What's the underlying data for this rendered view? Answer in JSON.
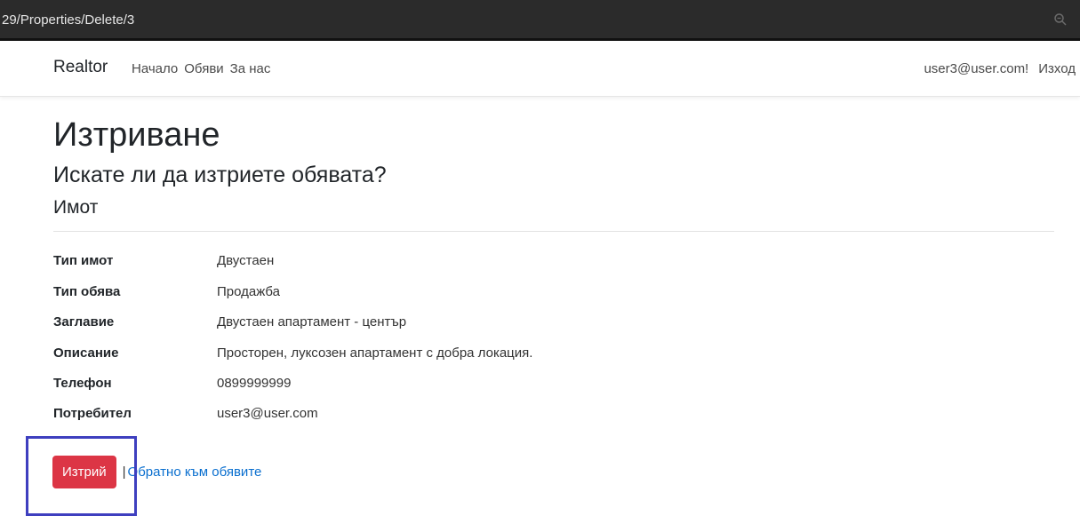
{
  "browser": {
    "url": "29/Properties/Delete/3",
    "zoom_icon": "magnifier-icon"
  },
  "navbar": {
    "brand": "Realtor",
    "links": [
      "Начало",
      "Обяви",
      "За нас"
    ],
    "user": "user3@user.com!",
    "logout": "Изход"
  },
  "page": {
    "title": "Изтриване",
    "question": "Искате ли да изтриете обявата?",
    "section": "Имот"
  },
  "details": [
    {
      "label": "Тип имот",
      "value": "Двустаен"
    },
    {
      "label": "Тип обява",
      "value": "Продажба"
    },
    {
      "label": "Заглавие",
      "value": "Двустаен апартамент - център"
    },
    {
      "label": "Описание",
      "value": "Просторен, луксозен апартамент с добра локация."
    },
    {
      "label": "Телефон",
      "value": "0899999999"
    },
    {
      "label": "Потребител",
      "value": "user3@user.com"
    }
  ],
  "actions": {
    "delete_label": "Изтрий",
    "separator": "|",
    "back_label": "Обратно към обявите"
  },
  "colors": {
    "danger": "#dc3545",
    "link": "#0a6fcf",
    "highlight": "#3e3fbf"
  }
}
